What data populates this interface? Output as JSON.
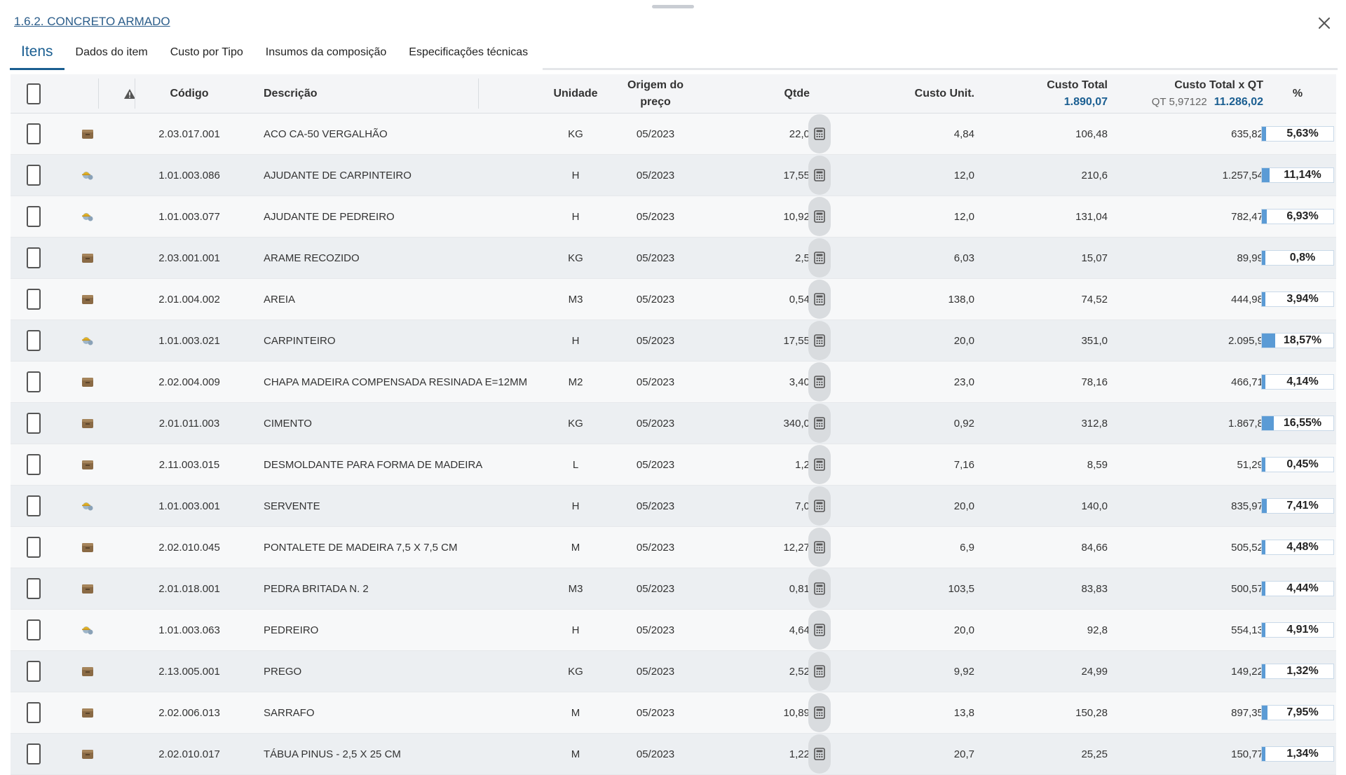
{
  "breadcrumb": "1.6.2. CONCRETO ARMADO",
  "tabs": [
    {
      "label": "Itens"
    },
    {
      "label": "Dados do item"
    },
    {
      "label": "Custo por Tipo"
    },
    {
      "label": "Insumos da composição"
    },
    {
      "label": "Especificações técnicas"
    }
  ],
  "header": {
    "codigo": "Código",
    "descricao": "Descrição",
    "unidade": "Unidade",
    "origem_line1": "Origem do",
    "origem_line2": "preço",
    "qtde": "Qtde",
    "custo_unit": "Custo Unit.",
    "custo_total": "Custo Total",
    "custo_total_sum": "1.890,07",
    "custo_total_qt": "Custo Total x QT",
    "qt_label": "QT 5,97122",
    "custo_total_qt_sum": "11.286,02",
    "pct": "%"
  },
  "icons": {
    "material": "material-box-icon",
    "labor": "worker-icon",
    "warning": "warning-icon",
    "calculator": "calculator-icon",
    "close": "close-icon"
  },
  "colors": {
    "accent": "#1a5e91",
    "bar": "#5b9bd5"
  },
  "rows": [
    {
      "type": "material",
      "codigo": "2.03.017.001",
      "descricao": "ACO CA-50 VERGALHÃO",
      "unidade": "KG",
      "origem": "05/2023",
      "qtde": "22,0",
      "custo_unit": "4,84",
      "custo_total": "106,48",
      "custo_total_qt": "635,82",
      "pct": "5,63%",
      "pct_value": 5.63
    },
    {
      "type": "labor",
      "codigo": "1.01.003.086",
      "descricao": "AJUDANTE DE CARPINTEIRO",
      "unidade": "H",
      "origem": "05/2023",
      "qtde": "17,55",
      "custo_unit": "12,0",
      "custo_total": "210,6",
      "custo_total_qt": "1.257,54",
      "pct": "11,14%",
      "pct_value": 11.14
    },
    {
      "type": "labor",
      "codigo": "1.01.003.077",
      "descricao": "AJUDANTE DE PEDREIRO",
      "unidade": "H",
      "origem": "05/2023",
      "qtde": "10,92",
      "custo_unit": "12,0",
      "custo_total": "131,04",
      "custo_total_qt": "782,47",
      "pct": "6,93%",
      "pct_value": 6.93
    },
    {
      "type": "material",
      "codigo": "2.03.001.001",
      "descricao": "ARAME RECOZIDO",
      "unidade": "KG",
      "origem": "05/2023",
      "qtde": "2,5",
      "custo_unit": "6,03",
      "custo_total": "15,07",
      "custo_total_qt": "89,99",
      "pct": "0,8%",
      "pct_value": 0.8
    },
    {
      "type": "material",
      "codigo": "2.01.004.002",
      "descricao": "AREIA",
      "unidade": "M3",
      "origem": "05/2023",
      "qtde": "0,54",
      "custo_unit": "138,0",
      "custo_total": "74,52",
      "custo_total_qt": "444,98",
      "pct": "3,94%",
      "pct_value": 3.94
    },
    {
      "type": "labor",
      "codigo": "1.01.003.021",
      "descricao": "CARPINTEIRO",
      "unidade": "H",
      "origem": "05/2023",
      "qtde": "17,55",
      "custo_unit": "20,0",
      "custo_total": "351,0",
      "custo_total_qt": "2.095,9",
      "pct": "18,57%",
      "pct_value": 18.57
    },
    {
      "type": "material",
      "codigo": "2.02.004.009",
      "descricao": "CHAPA MADEIRA COMPENSADA RESINADA E=12MM",
      "unidade": "M2",
      "origem": "05/2023",
      "qtde": "3,40",
      "custo_unit": "23,0",
      "custo_total": "78,16",
      "custo_total_qt": "466,71",
      "pct": "4,14%",
      "pct_value": 4.14
    },
    {
      "type": "material",
      "codigo": "2.01.011.003",
      "descricao": "CIMENTO",
      "unidade": "KG",
      "origem": "05/2023",
      "qtde": "340,0",
      "custo_unit": "0,92",
      "custo_total": "312,8",
      "custo_total_qt": "1.867,8",
      "pct": "16,55%",
      "pct_value": 16.55
    },
    {
      "type": "material",
      "codigo": "2.11.003.015",
      "descricao": "DESMOLDANTE PARA FORMA DE MADEIRA",
      "unidade": "L",
      "origem": "05/2023",
      "qtde": "1,2",
      "custo_unit": "7,16",
      "custo_total": "8,59",
      "custo_total_qt": "51,29",
      "pct": "0,45%",
      "pct_value": 0.45
    },
    {
      "type": "labor",
      "codigo": "1.01.003.001",
      "descricao": "SERVENTE",
      "unidade": "H",
      "origem": "05/2023",
      "qtde": "7,0",
      "custo_unit": "20,0",
      "custo_total": "140,0",
      "custo_total_qt": "835,97",
      "pct": "7,41%",
      "pct_value": 7.41
    },
    {
      "type": "material",
      "codigo": "2.02.010.045",
      "descricao": "PONTALETE DE MADEIRA 7,5 X 7,5 CM",
      "unidade": "M",
      "origem": "05/2023",
      "qtde": "12,27",
      "custo_unit": "6,9",
      "custo_total": "84,66",
      "custo_total_qt": "505,52",
      "pct": "4,48%",
      "pct_value": 4.48
    },
    {
      "type": "material",
      "codigo": "2.01.018.001",
      "descricao": "PEDRA BRITADA N. 2",
      "unidade": "M3",
      "origem": "05/2023",
      "qtde": "0,81",
      "custo_unit": "103,5",
      "custo_total": "83,83",
      "custo_total_qt": "500,57",
      "pct": "4,44%",
      "pct_value": 4.44
    },
    {
      "type": "labor",
      "codigo": "1.01.003.063",
      "descricao": "PEDREIRO",
      "unidade": "H",
      "origem": "05/2023",
      "qtde": "4,64",
      "custo_unit": "20,0",
      "custo_total": "92,8",
      "custo_total_qt": "554,13",
      "pct": "4,91%",
      "pct_value": 4.91
    },
    {
      "type": "material",
      "codigo": "2.13.005.001",
      "descricao": "PREGO",
      "unidade": "KG",
      "origem": "05/2023",
      "qtde": "2,52",
      "custo_unit": "9,92",
      "custo_total": "24,99",
      "custo_total_qt": "149,22",
      "pct": "1,32%",
      "pct_value": 1.32
    },
    {
      "type": "material",
      "codigo": "2.02.006.013",
      "descricao": "SARRAFO",
      "unidade": "M",
      "origem": "05/2023",
      "qtde": "10,89",
      "custo_unit": "13,8",
      "custo_total": "150,28",
      "custo_total_qt": "897,35",
      "pct": "7,95%",
      "pct_value": 7.95
    },
    {
      "type": "material",
      "codigo": "2.02.010.017",
      "descricao": "TÁBUA PINUS - 2,5 X 25 CM",
      "unidade": "M",
      "origem": "05/2023",
      "qtde": "1,22",
      "custo_unit": "20,7",
      "custo_total": "25,25",
      "custo_total_qt": "150,77",
      "pct": "1,34%",
      "pct_value": 1.34
    }
  ]
}
